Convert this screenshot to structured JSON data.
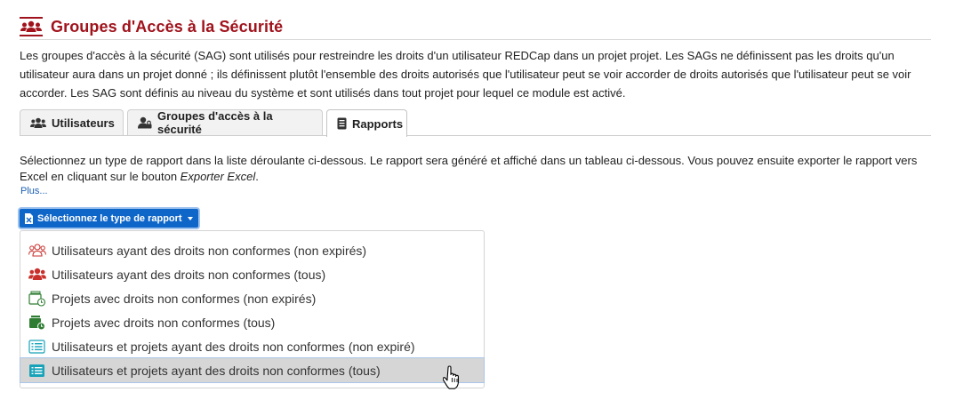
{
  "header": {
    "title": "Groupes d'Accès à la Sécurité",
    "icon": "users-group-icon"
  },
  "intro_text": "Les groupes d'accès à la sécurité (SAG) sont utilisés pour restreindre les droits d'un utilisateur REDCap dans un projet projet. Les SAGs ne définissent pas les droits qu'un utilisateur aura dans un projet donné ; ils définissent plutôt l'ensemble des droits autorisés que l'utilisateur peut se voir accorder de droits autorisés que l'utilisateur peut se voir accorder. Les SAG sont définis au niveau du système et sont utilisés dans tout projet pour lequel ce module est activé.",
  "tabs": [
    {
      "label": "Utilisateurs",
      "icon": "users-icon",
      "active": false
    },
    {
      "label": "Groupes d'accès à la sécurité",
      "icon": "user-lock-icon",
      "active": false
    },
    {
      "label": "Rapports",
      "icon": "report-icon",
      "active": true
    }
  ],
  "reports": {
    "description_main": "Sélectionnez un type de rapport dans la liste déroulante ci-dessous. Le rapport sera généré et affiché dans un tableau ci-dessous. Vous pouvez ensuite exporter le rapport vers Excel en cliquant sur le bouton ",
    "description_em": "Exporter Excel",
    "description_end": ".",
    "more_link": "Plus...",
    "dropdown_label": "Sélectionnez le type de rapport",
    "menu_items": [
      {
        "label": "Utilisateurs ayant des droits non conformes (non expirés)",
        "icon": "users-outline-icon",
        "color": "#c9302c"
      },
      {
        "label": "Utilisateurs ayant des droits non conformes (tous)",
        "icon": "users-solid-icon",
        "color": "#c9302c"
      },
      {
        "label": "Projets avec droits non conformes (non expirés)",
        "icon": "folder-clock-outline-icon",
        "color": "#2e7d32"
      },
      {
        "label": "Projets avec droits non conformes (tous)",
        "icon": "folder-clock-solid-icon",
        "color": "#2e7d32"
      },
      {
        "label": "Utilisateurs et projets ayant des droits non conformes (non expiré)",
        "icon": "list-outline-icon",
        "color": "#17a2b8"
      },
      {
        "label": "Utilisateurs et projets ayant des droits non conformes (tous)",
        "icon": "list-solid-icon",
        "color": "#17a2b8"
      }
    ],
    "hovered_index": 5
  },
  "colors": {
    "title": "#a0131c",
    "primary_button": "#0f66c9",
    "link": "#1a5fb4"
  }
}
